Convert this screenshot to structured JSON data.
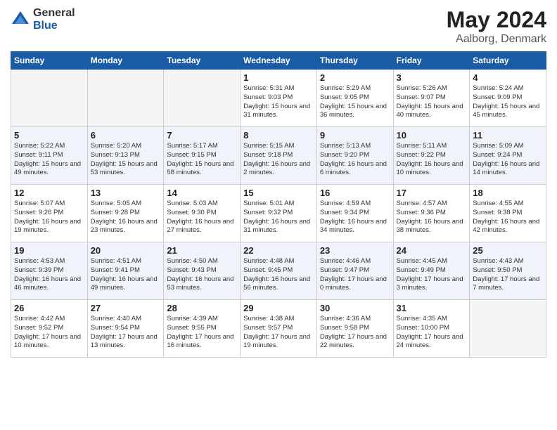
{
  "header": {
    "logo_general": "General",
    "logo_blue": "Blue",
    "title": "May 2024",
    "subtitle": "Aalborg, Denmark"
  },
  "weekdays": [
    "Sunday",
    "Monday",
    "Tuesday",
    "Wednesday",
    "Thursday",
    "Friday",
    "Saturday"
  ],
  "weeks": [
    [
      {
        "num": "",
        "info": ""
      },
      {
        "num": "",
        "info": ""
      },
      {
        "num": "",
        "info": ""
      },
      {
        "num": "1",
        "info": "Sunrise: 5:31 AM\nSunset: 9:03 PM\nDaylight: 15 hours\nand 31 minutes."
      },
      {
        "num": "2",
        "info": "Sunrise: 5:29 AM\nSunset: 9:05 PM\nDaylight: 15 hours\nand 36 minutes."
      },
      {
        "num": "3",
        "info": "Sunrise: 5:26 AM\nSunset: 9:07 PM\nDaylight: 15 hours\nand 40 minutes."
      },
      {
        "num": "4",
        "info": "Sunrise: 5:24 AM\nSunset: 9:09 PM\nDaylight: 15 hours\nand 45 minutes."
      }
    ],
    [
      {
        "num": "5",
        "info": "Sunrise: 5:22 AM\nSunset: 9:11 PM\nDaylight: 15 hours\nand 49 minutes."
      },
      {
        "num": "6",
        "info": "Sunrise: 5:20 AM\nSunset: 9:13 PM\nDaylight: 15 hours\nand 53 minutes."
      },
      {
        "num": "7",
        "info": "Sunrise: 5:17 AM\nSunset: 9:15 PM\nDaylight: 15 hours\nand 58 minutes."
      },
      {
        "num": "8",
        "info": "Sunrise: 5:15 AM\nSunset: 9:18 PM\nDaylight: 16 hours\nand 2 minutes."
      },
      {
        "num": "9",
        "info": "Sunrise: 5:13 AM\nSunset: 9:20 PM\nDaylight: 16 hours\nand 6 minutes."
      },
      {
        "num": "10",
        "info": "Sunrise: 5:11 AM\nSunset: 9:22 PM\nDaylight: 16 hours\nand 10 minutes."
      },
      {
        "num": "11",
        "info": "Sunrise: 5:09 AM\nSunset: 9:24 PM\nDaylight: 16 hours\nand 14 minutes."
      }
    ],
    [
      {
        "num": "12",
        "info": "Sunrise: 5:07 AM\nSunset: 9:26 PM\nDaylight: 16 hours\nand 19 minutes."
      },
      {
        "num": "13",
        "info": "Sunrise: 5:05 AM\nSunset: 9:28 PM\nDaylight: 16 hours\nand 23 minutes."
      },
      {
        "num": "14",
        "info": "Sunrise: 5:03 AM\nSunset: 9:30 PM\nDaylight: 16 hours\nand 27 minutes."
      },
      {
        "num": "15",
        "info": "Sunrise: 5:01 AM\nSunset: 9:32 PM\nDaylight: 16 hours\nand 31 minutes."
      },
      {
        "num": "16",
        "info": "Sunrise: 4:59 AM\nSunset: 9:34 PM\nDaylight: 16 hours\nand 34 minutes."
      },
      {
        "num": "17",
        "info": "Sunrise: 4:57 AM\nSunset: 9:36 PM\nDaylight: 16 hours\nand 38 minutes."
      },
      {
        "num": "18",
        "info": "Sunrise: 4:55 AM\nSunset: 9:38 PM\nDaylight: 16 hours\nand 42 minutes."
      }
    ],
    [
      {
        "num": "19",
        "info": "Sunrise: 4:53 AM\nSunset: 9:39 PM\nDaylight: 16 hours\nand 46 minutes."
      },
      {
        "num": "20",
        "info": "Sunrise: 4:51 AM\nSunset: 9:41 PM\nDaylight: 16 hours\nand 49 minutes."
      },
      {
        "num": "21",
        "info": "Sunrise: 4:50 AM\nSunset: 9:43 PM\nDaylight: 16 hours\nand 53 minutes."
      },
      {
        "num": "22",
        "info": "Sunrise: 4:48 AM\nSunset: 9:45 PM\nDaylight: 16 hours\nand 56 minutes."
      },
      {
        "num": "23",
        "info": "Sunrise: 4:46 AM\nSunset: 9:47 PM\nDaylight: 17 hours\nand 0 minutes."
      },
      {
        "num": "24",
        "info": "Sunrise: 4:45 AM\nSunset: 9:49 PM\nDaylight: 17 hours\nand 3 minutes."
      },
      {
        "num": "25",
        "info": "Sunrise: 4:43 AM\nSunset: 9:50 PM\nDaylight: 17 hours\nand 7 minutes."
      }
    ],
    [
      {
        "num": "26",
        "info": "Sunrise: 4:42 AM\nSunset: 9:52 PM\nDaylight: 17 hours\nand 10 minutes."
      },
      {
        "num": "27",
        "info": "Sunrise: 4:40 AM\nSunset: 9:54 PM\nDaylight: 17 hours\nand 13 minutes."
      },
      {
        "num": "28",
        "info": "Sunrise: 4:39 AM\nSunset: 9:55 PM\nDaylight: 17 hours\nand 16 minutes."
      },
      {
        "num": "29",
        "info": "Sunrise: 4:38 AM\nSunset: 9:57 PM\nDaylight: 17 hours\nand 19 minutes."
      },
      {
        "num": "30",
        "info": "Sunrise: 4:36 AM\nSunset: 9:58 PM\nDaylight: 17 hours\nand 22 minutes."
      },
      {
        "num": "31",
        "info": "Sunrise: 4:35 AM\nSunset: 10:00 PM\nDaylight: 17 hours\nand 24 minutes."
      },
      {
        "num": "",
        "info": ""
      }
    ]
  ]
}
